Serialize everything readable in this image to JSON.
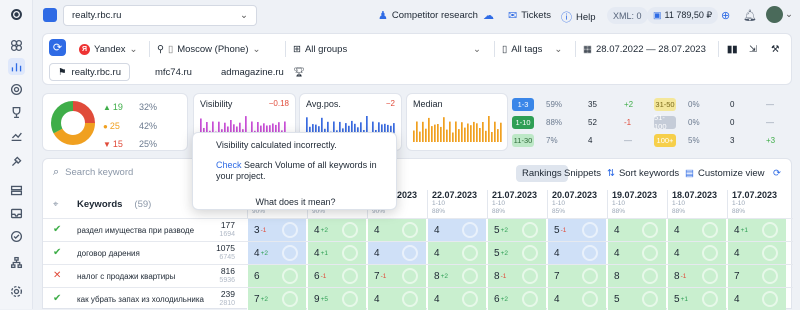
{
  "topbar": {
    "project": "realty.rbc.ru",
    "competitor_research": "Competitor research",
    "tickets": "Tickets",
    "help": "Help",
    "xml": "XML: 0",
    "balance": "11 789,50 ₽"
  },
  "filters": {
    "engine": "Yandex",
    "region": "Moscow (Phone)",
    "groups": "All groups",
    "tags": "All tags",
    "date_range": "28.07.2022 — 28.07.2023"
  },
  "site_tabs": [
    "realty.rbc.ru",
    "mfc74.ru",
    "admagazine.ru"
  ],
  "distribution": [
    {
      "count": "19",
      "pct": "32%",
      "color": "#3fae49",
      "arrow": "▲"
    },
    {
      "count": "25",
      "pct": "42%",
      "color": "#f0a020",
      "arrow": "●"
    },
    {
      "count": "15",
      "pct": "25%",
      "color": "#e04b3a",
      "arrow": "▼"
    }
  ],
  "metrics": {
    "visibility": {
      "title": "Visibility",
      "delta": "−0.18",
      "color": "#c84fd6"
    },
    "avgpos": {
      "title": "Avg.pos.",
      "delta": "−2",
      "color": "#3a6be0"
    },
    "median": {
      "title": "Median",
      "delta": "",
      "color": "#f0a020"
    }
  },
  "positions_left": [
    {
      "label": "1-3",
      "pct": "59%",
      "count": "35",
      "delta": "+2",
      "delta_color": "#3fae49",
      "bg": "#3a86e8",
      "fg": "#fff"
    },
    {
      "label": "1-10",
      "pct": "88%",
      "count": "52",
      "delta": "-1",
      "delta_color": "#e04b3a",
      "bg": "#2f9f55",
      "fg": "#fff"
    },
    {
      "label": "11-30",
      "pct": "7%",
      "count": "4",
      "delta": "—",
      "delta_color": "#8b97a8",
      "bg": "#bde8c7",
      "fg": "#2f6b3a"
    }
  ],
  "positions_right": [
    {
      "label": "31-50",
      "pct": "0%",
      "count": "0",
      "delta": "—",
      "delta_color": "#8b97a8",
      "bg": "#f4e79a",
      "fg": "#7a6a1a"
    },
    {
      "label": "51-100",
      "pct": "0%",
      "count": "0",
      "delta": "—",
      "delta_color": "#8b97a8",
      "bg": "#c5ccd8",
      "fg": "#fff"
    },
    {
      "label": "100+",
      "pct": "5%",
      "count": "3",
      "delta": "+3",
      "delta_color": "#3fae49",
      "bg": "#f6cf4a",
      "fg": "#fff"
    }
  ],
  "tooltip": {
    "title": "Visibility calculated incorrectly.",
    "link": "Check",
    "body": " Search Volume of all keywords in your project.",
    "footer": "What does it mean?"
  },
  "table": {
    "search_placeholder": "Search keyword",
    "tab_rankings": "Rankings",
    "tab_snippets": "Snippets",
    "sort": "Sort keywords",
    "customize": "Customize view",
    "keywords_header": "Keywords",
    "keywords_count": "(59)",
    "dates": [
      {
        "date": "27.07.2023",
        "sub1": "1-10",
        "sub2": "90%"
      },
      {
        "date": "24.07.2023",
        "sub1": "1-10",
        "sub2": "90%"
      },
      {
        "date": "23.07.2023",
        "sub1": "1-10",
        "sub2": "90%"
      },
      {
        "date": "22.07.2023",
        "sub1": "1-10",
        "sub2": "88%"
      },
      {
        "date": "21.07.2023",
        "sub1": "1-10",
        "sub2": "88%"
      },
      {
        "date": "20.07.2023",
        "sub1": "1-10",
        "sub2": "85%"
      },
      {
        "date": "19.07.2023",
        "sub1": "1-10",
        "sub2": "88%"
      },
      {
        "date": "18.07.2023",
        "sub1": "1-10",
        "sub2": "88%"
      },
      {
        "date": "17.07.2023",
        "sub1": "1-10",
        "sub2": "88%"
      }
    ],
    "rows": [
      {
        "status": "✔",
        "status_color": "#3fae49",
        "keyword": "раздел имущества при разводе",
        "vol": "177",
        "vol2": "1694",
        "cells": [
          [
            "3",
            "-1",
            "b"
          ],
          [
            "4",
            "+2",
            "g"
          ],
          [
            "4",
            "",
            "g"
          ],
          [
            "4",
            "",
            "b"
          ],
          [
            "5",
            "+2",
            "g"
          ],
          [
            "5",
            "-1",
            "b"
          ],
          [
            "4",
            "",
            "g"
          ],
          [
            "4",
            "",
            "g"
          ],
          [
            "4",
            "+1",
            "g"
          ]
        ]
      },
      {
        "status": "✔",
        "status_color": "#3fae49",
        "keyword": "договор дарения",
        "vol": "1075",
        "vol2": "6745",
        "cells": [
          [
            "4",
            "+2",
            "b"
          ],
          [
            "4",
            "+1",
            "g"
          ],
          [
            "4",
            "",
            "b"
          ],
          [
            "4",
            "",
            "g"
          ],
          [
            "5",
            "+2",
            "g"
          ],
          [
            "4",
            "",
            "b"
          ],
          [
            "4",
            "",
            "g"
          ],
          [
            "4",
            "",
            "g"
          ],
          [
            "4",
            "",
            "g"
          ]
        ]
      },
      {
        "status": "✕",
        "status_color": "#e04b3a",
        "keyword": "налог с продажи квартиры",
        "vol": "816",
        "vol2": "5936",
        "cells": [
          [
            "6",
            "",
            "g"
          ],
          [
            "6",
            "-1",
            "g"
          ],
          [
            "7",
            "-1",
            "g"
          ],
          [
            "8",
            "+2",
            "g"
          ],
          [
            "8",
            "-1",
            "g"
          ],
          [
            "7",
            "",
            "g"
          ],
          [
            "8",
            "",
            "g"
          ],
          [
            "8",
            "-1",
            "g"
          ],
          [
            "7",
            "",
            "g"
          ]
        ]
      },
      {
        "status": "✔",
        "status_color": "#3fae49",
        "keyword": "как убрать запах из холодильника",
        "vol": "239",
        "vol2": "2810",
        "cells": [
          [
            "7",
            "+2",
            "g"
          ],
          [
            "9",
            "+5",
            "g"
          ],
          [
            "4",
            "",
            "g"
          ],
          [
            "4",
            "",
            "g"
          ],
          [
            "6",
            "+2",
            "g"
          ],
          [
            "4",
            "",
            "g"
          ],
          [
            "5",
            "",
            "g"
          ],
          [
            "5",
            "+1",
            "g"
          ],
          [
            "4",
            "",
            "g"
          ]
        ]
      }
    ]
  }
}
